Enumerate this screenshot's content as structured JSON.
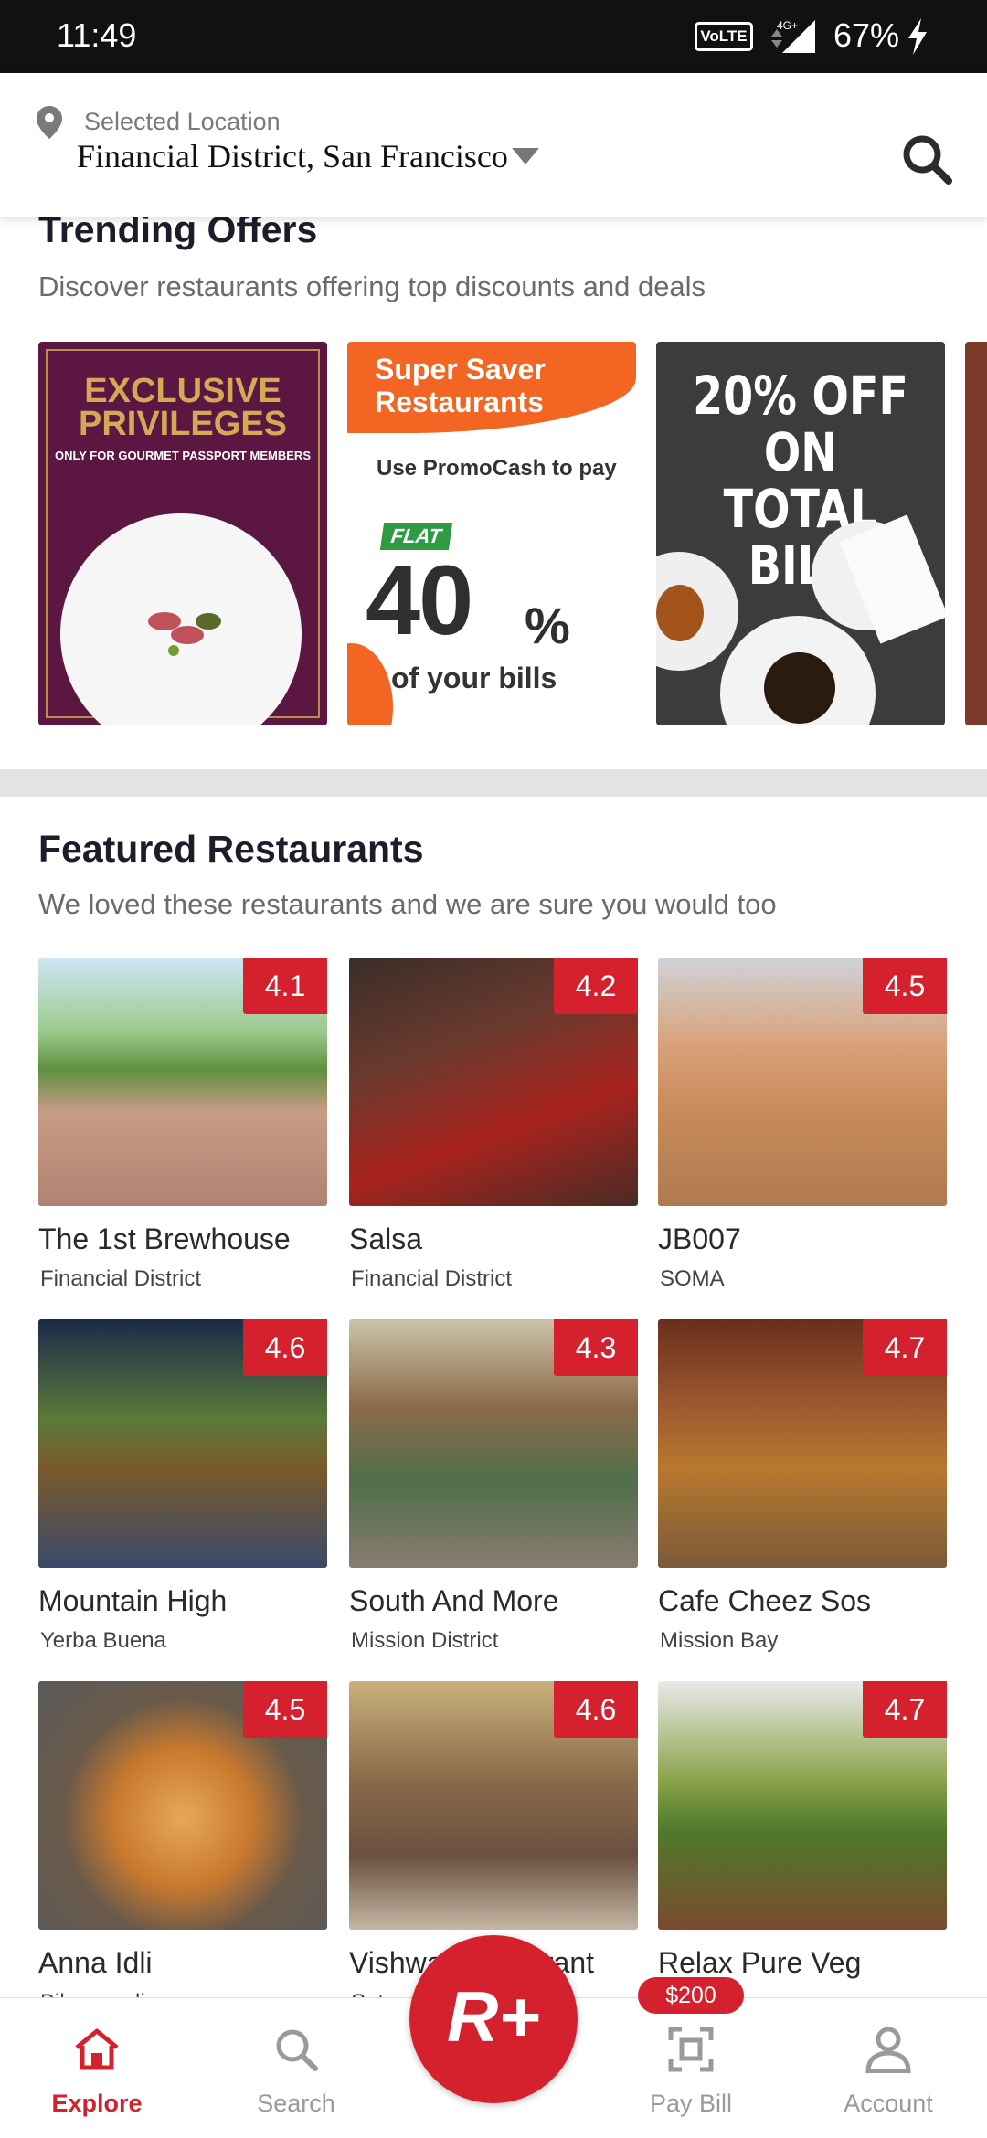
{
  "status_bar": {
    "time": "11:49",
    "volte": "VoLTE",
    "network": "4G+",
    "battery": "67%"
  },
  "header": {
    "location_label": "Selected Location",
    "location_value": "Financial District, San Francisco",
    "icons": [
      "pin-icon",
      "caret-down-icon",
      "search-icon"
    ]
  },
  "trending": {
    "title": "Trending Offers",
    "subtitle": "Discover restaurants offering top discounts and deals",
    "offers": [
      {
        "headline": "EXCLUSIVE PRIVILEGES",
        "subline": "ONLY FOR GOURMET PASSPORT MEMBERS"
      },
      {
        "headline": "Super Saver Restaurants",
        "line1": "Use PromoCash to pay",
        "tag": "FLAT",
        "amount": "40",
        "percent": "%",
        "line2": "of your bills"
      },
      {
        "headline": "20% OFF ON TOTAL BILL"
      }
    ]
  },
  "featured": {
    "title": "Featured Restaurants",
    "subtitle": "We loved these restaurants and we are sure you would too",
    "restaurants": [
      {
        "name": "The 1st Brewhouse",
        "area": "Financial District",
        "rating": "4.1"
      },
      {
        "name": "Salsa",
        "area": "Financial District",
        "rating": "4.2"
      },
      {
        "name": "JB007",
        "area": "SOMA",
        "rating": "4.5"
      },
      {
        "name": "Mountain High",
        "area": "Yerba Buena",
        "rating": "4.6"
      },
      {
        "name": "South And More",
        "area": "Mission District",
        "rating": "4.3"
      },
      {
        "name": "Cafe Cheez Sos",
        "area": "Mission Bay",
        "rating": "4.7"
      },
      {
        "name": "Anna Idli",
        "area": "Bibwewadi",
        "rating": "4.5"
      },
      {
        "name": "Vishwa Restaurant",
        "area": "Satara Road",
        "rating": "4.6"
      },
      {
        "name": "Relax Pure Veg",
        "area": "",
        "rating": "4.7"
      }
    ]
  },
  "bottom_nav": {
    "items": [
      {
        "label": "Explore",
        "icon": "home-icon",
        "active": true
      },
      {
        "label": "Search",
        "icon": "search-icon",
        "active": false
      },
      {
        "label": "Pay Bill",
        "icon": "scan-icon",
        "active": false
      },
      {
        "label": "Account",
        "icon": "user-icon",
        "active": false
      }
    ],
    "fab_label": "R+",
    "badge": "$200"
  },
  "colors": {
    "brand_red": "#d4212d",
    "header_bg": "#ffffff",
    "status_bar_bg": "#111111",
    "divider": "#e3e3e3"
  }
}
